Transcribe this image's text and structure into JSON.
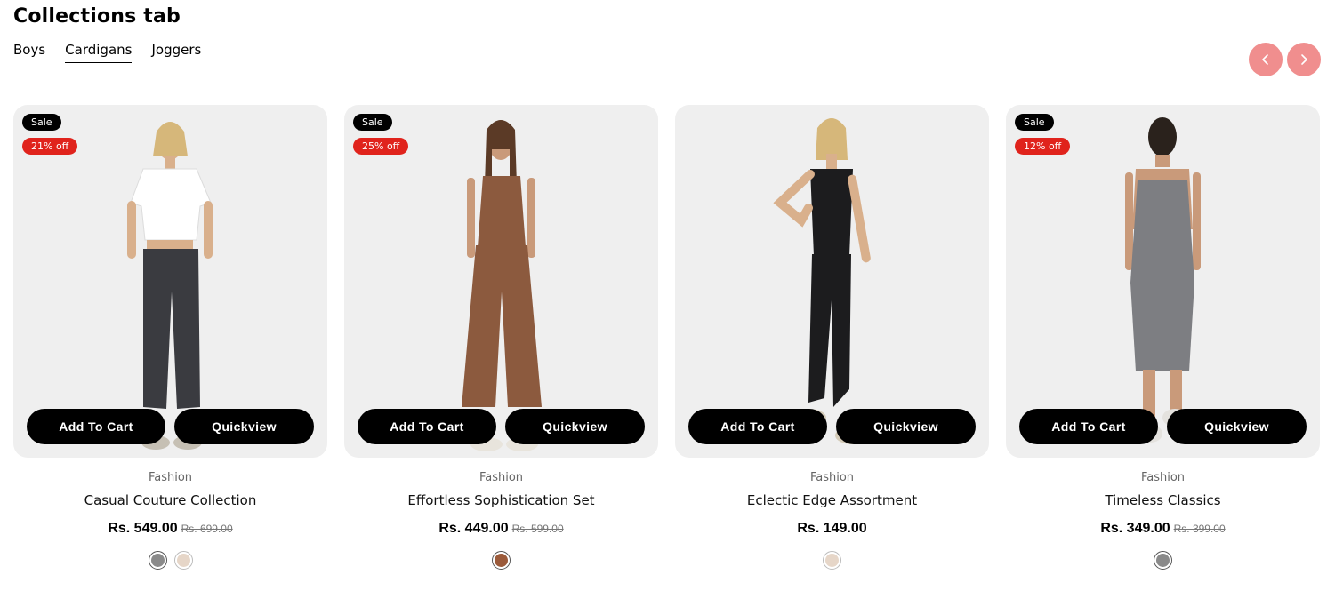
{
  "page": {
    "title": "Collections tab"
  },
  "tabs": [
    {
      "label": "Boys"
    },
    {
      "label": "Cardigans"
    },
    {
      "label": "Joggers"
    }
  ],
  "icons": {
    "prev": "chevron-left-icon",
    "next": "chevron-right-icon"
  },
  "colors": {
    "accent": "#f08e8e",
    "sale": "#000000",
    "discount": "#e0231c",
    "card_bg": "#efefef"
  },
  "products": [
    {
      "sale_label": "Sale",
      "discount_label": "21% off",
      "add_label": "Add To Cart",
      "quickview_label": "Quickview",
      "vendor": "Fashion",
      "name": "Casual Couture Collection",
      "price": "Rs. 549.00",
      "compare_price": "Rs. 699.00",
      "swatches": [
        "#8a8a8a",
        "#c9a88f"
      ]
    },
    {
      "sale_label": "Sale",
      "discount_label": "25% off",
      "add_label": "Add To Cart",
      "quickview_label": "Quickview",
      "vendor": "Fashion",
      "name": "Effortless Sophistication Set",
      "price": "Rs. 449.00",
      "compare_price": "Rs. 599.00",
      "swatches": [
        "#9b5a3a"
      ]
    },
    {
      "sale_label": "",
      "discount_label": "",
      "add_label": "Add To Cart",
      "quickview_label": "Quickview",
      "vendor": "Fashion",
      "name": "Eclectic Edge Assortment",
      "price": "Rs. 149.00",
      "compare_price": "",
      "swatches": [
        "#c9a88f"
      ]
    },
    {
      "sale_label": "Sale",
      "discount_label": "12% off",
      "add_label": "Add To Cart",
      "quickview_label": "Quickview",
      "vendor": "Fashion",
      "name": "Timeless Classics",
      "price": "Rs. 349.00",
      "compare_price": "Rs. 399.00",
      "swatches": [
        "#8a8a8a"
      ]
    }
  ]
}
